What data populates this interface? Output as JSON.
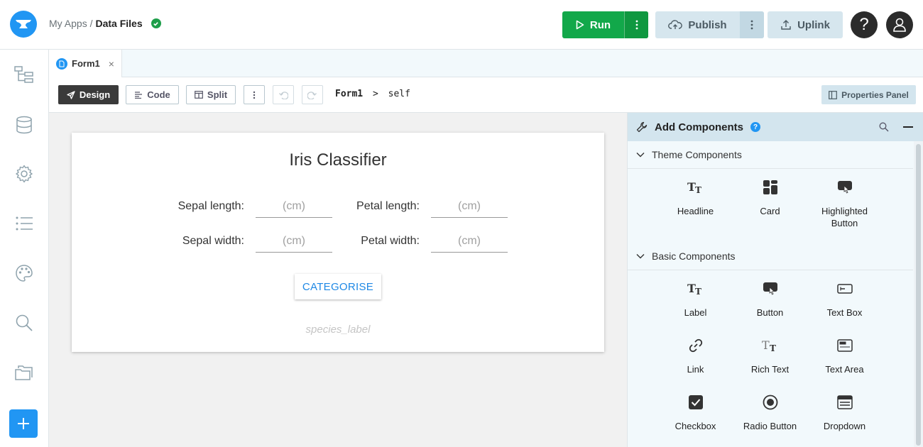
{
  "breadcrumb": {
    "root": "My Apps /",
    "current": "Data Files"
  },
  "topbar": {
    "run_label": "Run",
    "publish_label": "Publish",
    "uplink_label": "Uplink",
    "help_label": "?"
  },
  "tab": {
    "label": "Form1",
    "close": "×"
  },
  "toolbar": {
    "design_label": "Design",
    "code_label": "Code",
    "split_label": "Split",
    "path_form": "Form1",
    "path_sep": ">",
    "path_self": "self",
    "properties_label": "Properties Panel"
  },
  "form": {
    "title": "Iris Classifier",
    "sepal_length_label": "Sepal length:",
    "petal_length_label": "Petal length:",
    "sepal_width_label": "Sepal width:",
    "petal_width_label": "Petal width:",
    "input_placeholder": "(cm)",
    "button_label": "CATEGORISE",
    "species_placeholder": "species_label"
  },
  "panel": {
    "title": "Add Components",
    "help": "?",
    "theme_section": "Theme Components",
    "basic_section": "Basic Components",
    "theme_components": [
      "Headline",
      "Card",
      "Highlighted Button"
    ],
    "basic_components": [
      "Label",
      "Button",
      "Text Box",
      "Link",
      "Rich Text",
      "Text Area",
      "Checkbox",
      "Radio Button",
      "Dropdown"
    ]
  },
  "colors": {
    "accent": "#2196f3",
    "run_green": "#12a84a",
    "panel_bg": "#f2f9fc"
  }
}
